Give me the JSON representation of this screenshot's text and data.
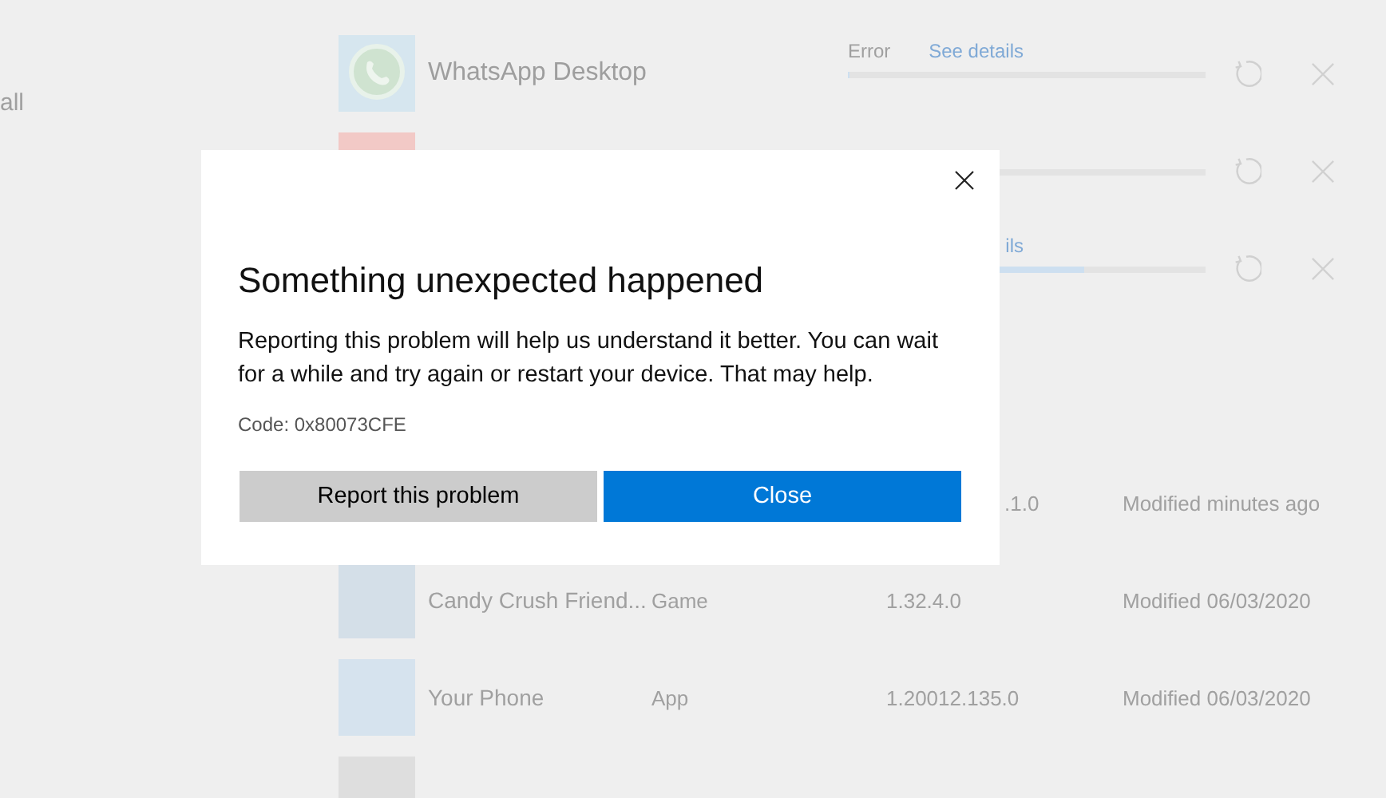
{
  "sidebar": {
    "items": [
      "all"
    ]
  },
  "downloads": [
    {
      "name": "WhatsApp Desktop",
      "status": "Error",
      "link": "See details",
      "level": 0
    },
    {
      "level": 0
    },
    {
      "link": "ils",
      "level": 0.66
    }
  ],
  "installed": [
    {
      "version": ".1.0",
      "modified": "Modified minutes ago"
    },
    {
      "name": "Candy Crush Friend...",
      "type": "Game",
      "version": "1.32.4.0",
      "modified": "Modified 06/03/2020"
    },
    {
      "name": "Your Phone",
      "type": "App",
      "version": "1.20012.135.0",
      "modified": "Modified 06/03/2020"
    }
  ],
  "dialog": {
    "title": "Something unexpected happened",
    "message": "Reporting this problem will help us understand it better. You can wait for a while and try again or restart your device. That may help.",
    "code": "Code: 0x80073CFE",
    "buttons": [
      {
        "label": "Report this problem",
        "kind": "secondary"
      },
      {
        "label": "Close",
        "kind": "primary"
      }
    ]
  }
}
